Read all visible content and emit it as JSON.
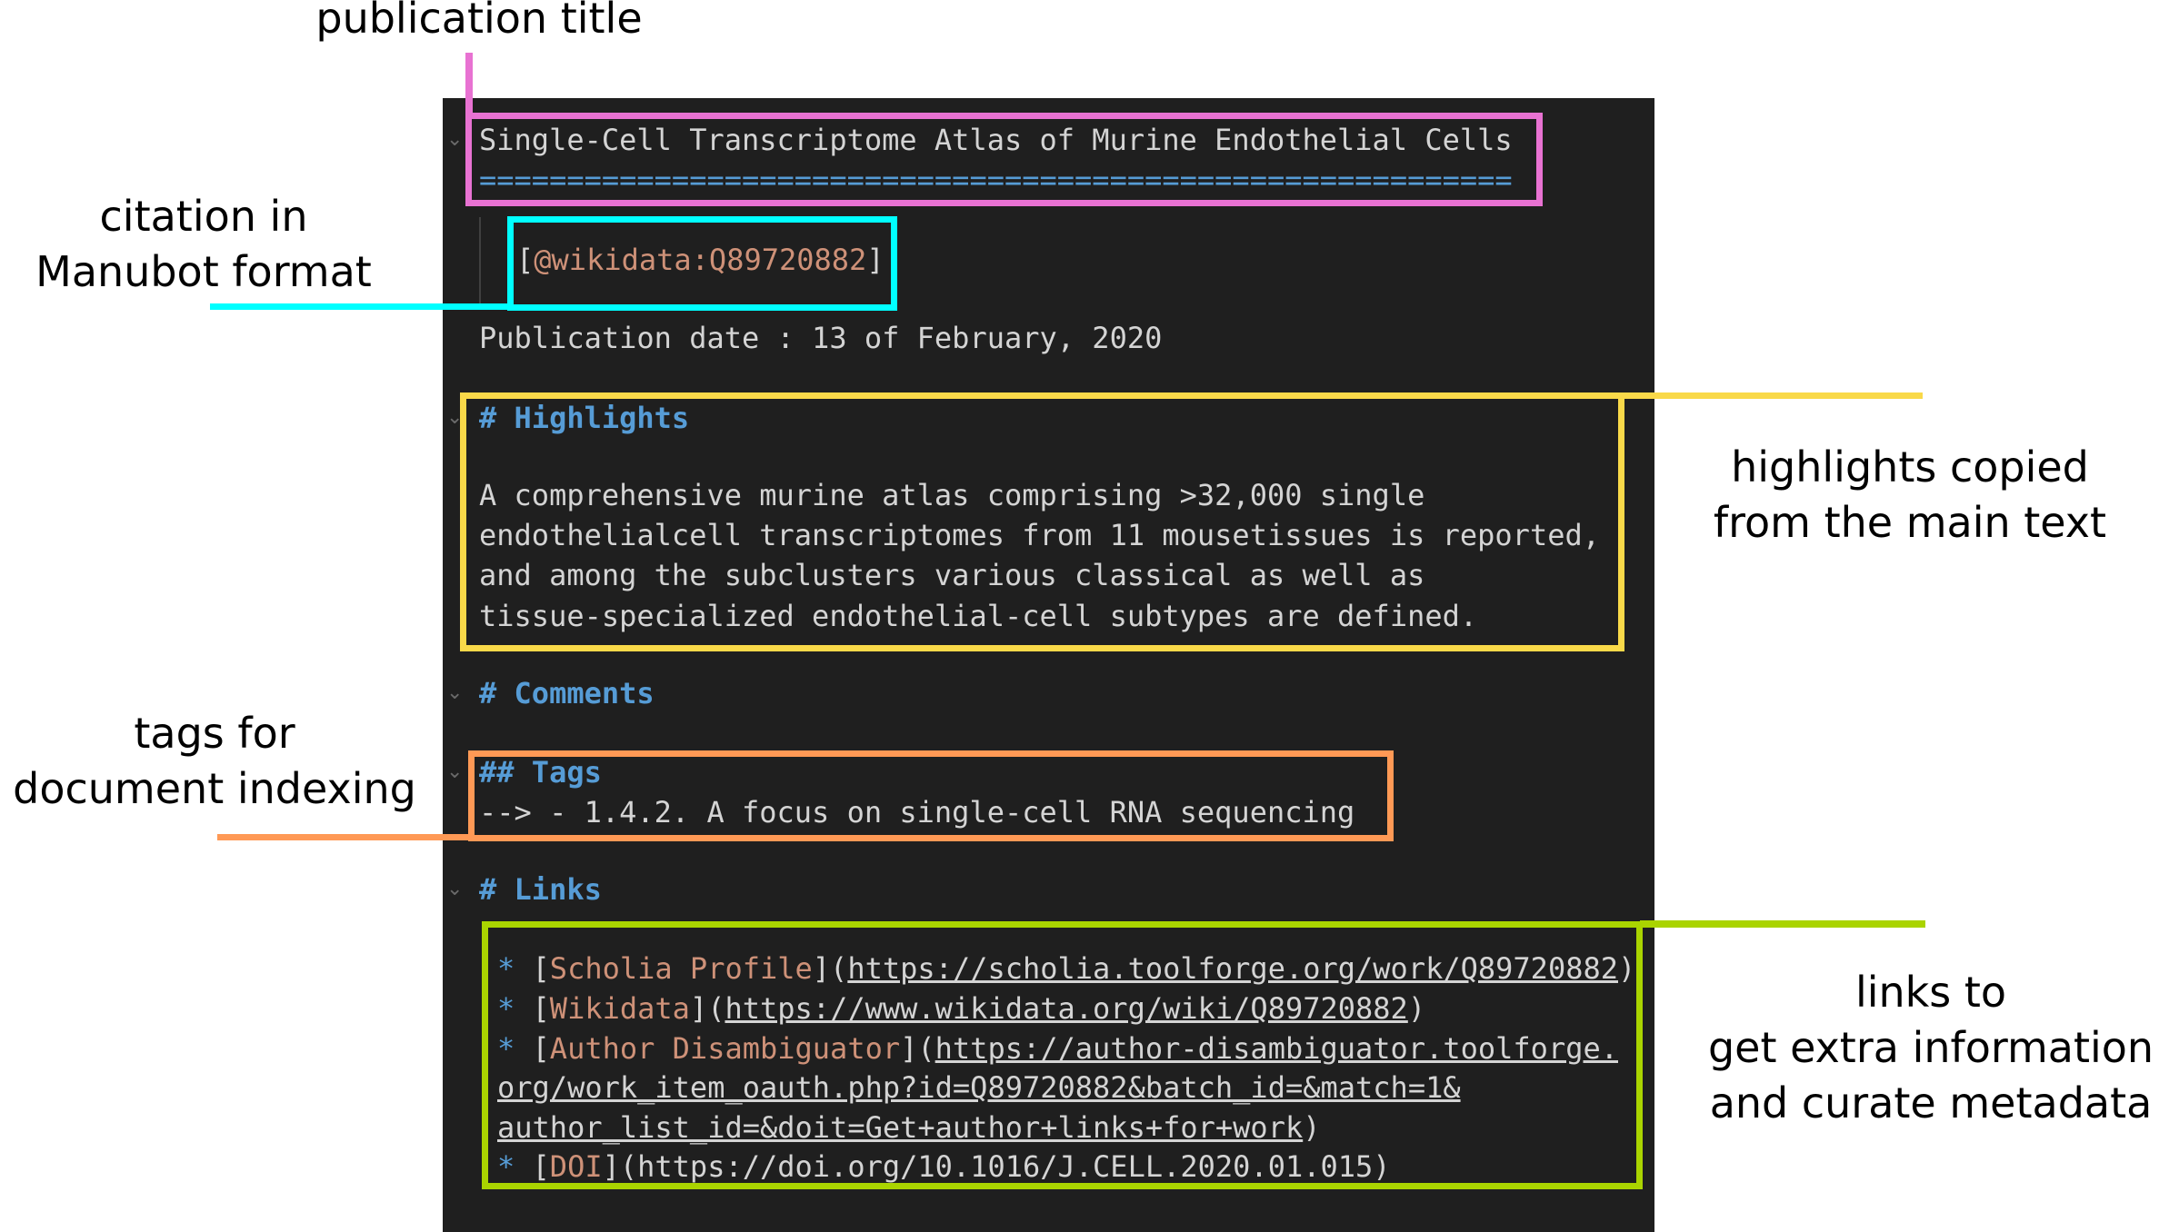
{
  "annotations": {
    "title_label": "publication title",
    "citation_label": [
      "citation in",
      "Manubot format"
    ],
    "highlights_label": [
      "highlights copied",
      "from the main text"
    ],
    "tags_label": [
      "tags for",
      "document indexing"
    ],
    "links_label": [
      "links to",
      "get extra information",
      "and curate metadata"
    ],
    "colors": {
      "title": "#e872d2",
      "citation": "#00ffff",
      "highlights": "#f9d949",
      "tags": "#ff9955",
      "links": "#aad400"
    }
  },
  "editor": {
    "title": "Single-Cell Transcriptome Atlas of Murine Endothelial Cells",
    "title_underline": "===========================================================",
    "citation": {
      "open": "[",
      "key": "@wikidata:Q89720882",
      "close": "]"
    },
    "publication_date": "Publication date : 13 of February, 2020",
    "highlights_heading": "# Highlights",
    "highlights_lines": [
      "A comprehensive murine atlas comprising >32,000 single",
      "endothelialcell transcriptomes from 11 mousetissues is reported,",
      "and among the subclusters various classical as well as",
      "tissue-specialized endothelial-cell subtypes are defined."
    ],
    "comments_heading": "# Comments",
    "tags_heading": "## Tags",
    "tags_line": "--> - 1.4.2. A focus on single-cell RNA sequencing",
    "links_heading": "# Links",
    "links": [
      {
        "label": "Scholia Profile",
        "url": "https://scholia.toolforge.org/work/Q89720882"
      },
      {
        "label": "Wikidata",
        "url": "https://www.wikidata.org/wiki/Q89720882"
      },
      {
        "label": "Author Disambiguator",
        "url_lines": [
          "https://author-disambiguator.toolforge.",
          "org/work_item_oauth.php?id=Q89720882&batch_id=&match=1&",
          "author_list_id=&doit=Get+author+links+for+work"
        ]
      },
      {
        "label": "DOI",
        "url": "https://doi.org/10.1016/J.CELL.2020.01.015"
      }
    ],
    "colors": {
      "background": "#1f1f1f",
      "text": "#d4d4d4",
      "heading": "#569cd6",
      "link_text": "#ce9178"
    }
  }
}
